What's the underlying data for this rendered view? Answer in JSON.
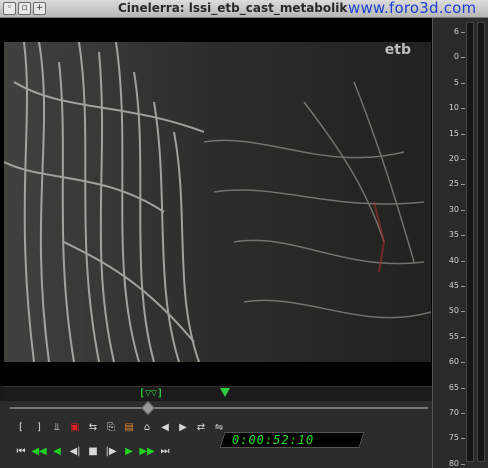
{
  "window": {
    "title": "Cinelerra: lssi_etb_cast_metabolik",
    "watermark": "www.foro3d.com",
    "buttons": [
      "menu",
      "minimize",
      "maximize"
    ]
  },
  "video": {
    "channel_logo": "etb"
  },
  "meter": {
    "scale": [
      "6",
      "0",
      "5",
      "10",
      "15",
      "20",
      "25",
      "30",
      "35",
      "40",
      "45",
      "50",
      "55",
      "60",
      "65",
      "70",
      "75",
      "80"
    ]
  },
  "timeline": {
    "io_marker": "[▽▽]"
  },
  "transport": {
    "timecode": "0:00:52:10",
    "edit_row": [
      {
        "name": "in-point",
        "glyph": "[",
        "color": "default"
      },
      {
        "name": "out-point",
        "glyph": "]",
        "color": "default"
      },
      {
        "name": "splice",
        "glyph": "⫫",
        "color": "default"
      },
      {
        "name": "overwrite",
        "glyph": "▣",
        "color": "red"
      },
      {
        "name": "lift",
        "glyph": "⇆",
        "color": "default"
      },
      {
        "name": "copy",
        "glyph": "⎘",
        "color": "default"
      },
      {
        "name": "paste",
        "glyph": "▤",
        "color": "orange"
      },
      {
        "name": "label",
        "glyph": "⌂",
        "color": "default"
      },
      {
        "name": "prev-label",
        "glyph": "◀",
        "color": "default"
      },
      {
        "name": "next-label",
        "glyph": "▶",
        "color": "default"
      },
      {
        "name": "to-clip",
        "glyph": "⇄",
        "color": "default"
      },
      {
        "name": "cut",
        "glyph": "⇋",
        "color": "default"
      }
    ],
    "play_row": [
      {
        "name": "rewind",
        "glyph": "⏮",
        "color": "default"
      },
      {
        "name": "fast-reverse",
        "glyph": "◀◀",
        "color": "green"
      },
      {
        "name": "reverse",
        "glyph": "◀",
        "color": "green"
      },
      {
        "name": "frame-back",
        "glyph": "◀|",
        "color": "default"
      },
      {
        "name": "stop",
        "glyph": "■",
        "color": "default"
      },
      {
        "name": "frame-forward",
        "glyph": "|▶",
        "color": "default"
      },
      {
        "name": "play",
        "glyph": "▶",
        "color": "green"
      },
      {
        "name": "fast-forward",
        "glyph": "▶▶",
        "color": "green"
      },
      {
        "name": "end",
        "glyph": "⏭",
        "color": "default"
      }
    ]
  },
  "colors": {
    "accent_green": "#22d022",
    "watermark_blue": "#1f3fd0",
    "record_red": "#e02020"
  }
}
